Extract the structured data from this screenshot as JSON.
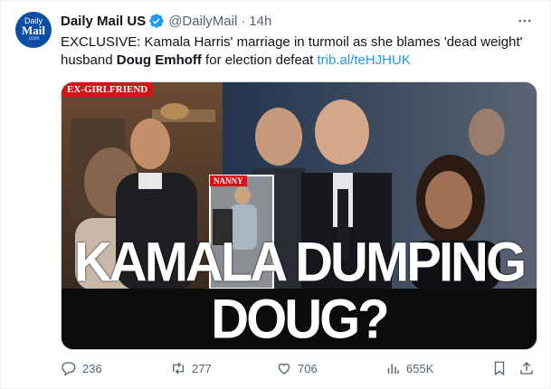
{
  "account": {
    "avatar_line1": "Daily",
    "avatar_line2": "Mail",
    "avatar_line3": ".com",
    "name": "Daily Mail US",
    "handle": "@DailyMail",
    "separator": "·",
    "time": "14h"
  },
  "tweet": {
    "text_part1": "EXCLUSIVE: Kamala Harris' marriage in turmoil as she blames 'dead weight' husband ",
    "text_bold": "Doug Emhoff",
    "text_part2": " for election defeat ",
    "link": "trib.al/teHJHUK"
  },
  "media": {
    "tag_exgirlfriend": "EX-GIRLFRIEND",
    "tag_nanny": "NANNY",
    "headline": "KAMALA DUMPING DOUG?"
  },
  "actions": {
    "replies": "236",
    "reposts": "277",
    "likes": "706",
    "views": "655K"
  },
  "icons": {
    "more": "more-icon",
    "verified": "verified-icon",
    "reply": "reply-icon",
    "repost": "repost-icon",
    "like": "like-icon",
    "views": "views-icon",
    "bookmark": "bookmark-icon",
    "share": "share-icon"
  },
  "colors": {
    "link": "#1d9bf0",
    "muted": "#536471",
    "brand": "#0a4fa3",
    "tag_red": "#d3121a"
  }
}
